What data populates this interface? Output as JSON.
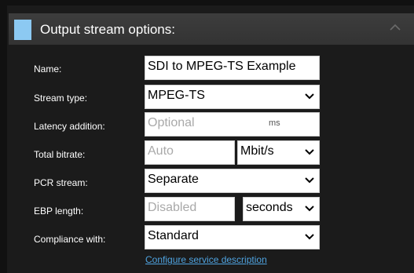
{
  "panel": {
    "title": "Output stream options:",
    "accent_color": "#8cc9f2",
    "collapse_icon": "chevron-up-icon"
  },
  "fields": {
    "name": {
      "label": "Name:",
      "value": "SDI to MPEG-TS Example"
    },
    "stream_type": {
      "label": "Stream type:",
      "value": "MPEG-TS"
    },
    "latency": {
      "label": "Latency addition:",
      "placeholder": "Optional",
      "unit": "ms"
    },
    "total_bitrate": {
      "label": "Total bitrate:",
      "placeholder": "Auto",
      "unit_value": "Mbit/s"
    },
    "pcr_stream": {
      "label": "PCR stream:",
      "value": "Separate"
    },
    "ebp_length": {
      "label": "EBP length:",
      "placeholder": "Disabled",
      "unit_value": "seconds"
    },
    "compliance": {
      "label": "Compliance with:",
      "value": "Standard"
    }
  },
  "links": {
    "configure_service": "Configure service description"
  },
  "colors": {
    "link": "#4fa3e0",
    "placeholder": "#a9a9a9"
  }
}
